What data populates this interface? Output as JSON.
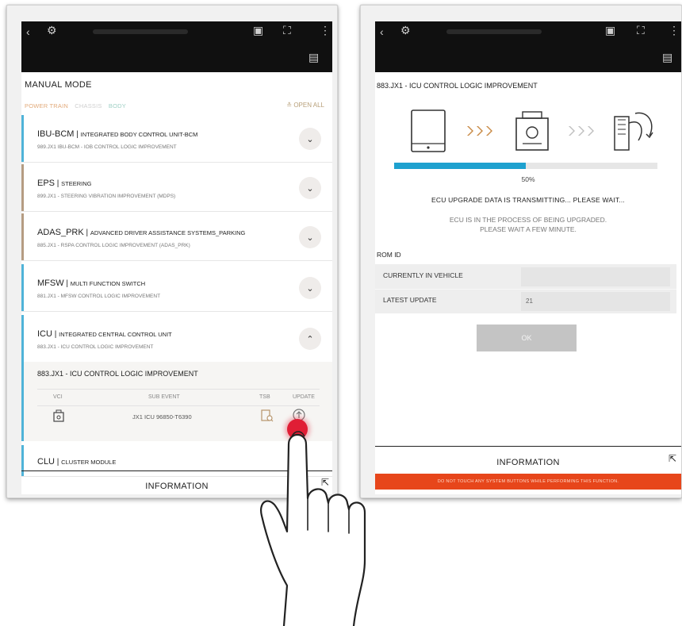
{
  "left_screen": {
    "mode_title": "MANUAL MODE",
    "category_tabs": [
      {
        "label": "POWER TRAIN",
        "color": "#e2aa7a"
      },
      {
        "label": "CHASSIS",
        "color": "#cfcfcf"
      },
      {
        "label": "BODY",
        "color": "#9fd0c5"
      }
    ],
    "open_all": "OPEN ALL",
    "systems": [
      {
        "code": "IBU-BCM",
        "full": "INTEGRATED BODY CONTROL UNIT-BCM",
        "sub": "989.JX1 IBU-BCM - IOB CONTROL LOGIC IMPROVEMENT",
        "accent": "#4fb3d8",
        "expanded": false
      },
      {
        "code": "EPS",
        "full": "STEERING",
        "sub": "899.JX1 - STEERING VIBRATION IMPROVEMENT (MDPS)",
        "accent": "#b59c82",
        "expanded": false
      },
      {
        "code": "ADAS_PRK",
        "full": "ADVANCED DRIVER ASSISTANCE SYSTEMS_PARKING",
        "sub": "885.JX1 - RSPA CONTROL LOGIC IMPROVEMENT (ADAS_PRK)",
        "accent": "#b59c82",
        "expanded": false
      },
      {
        "code": "MFSW",
        "full": "MULTI FUNCTION SWITCH",
        "sub": "881.JX1 - MFSW CONTROL LOGIC IMPROVEMENT",
        "accent": "#4fb3d8",
        "expanded": false
      },
      {
        "code": "ICU",
        "full": "INTEGRATED CENTRAL CONTROL UNIT",
        "sub": "883.JX1 - ICU CONTROL LOGIC IMPROVEMENT",
        "accent": "#4fb3d8",
        "expanded": true
      }
    ],
    "expanded_event": {
      "title": "883.JX1 - ICU CONTROL LOGIC IMPROVEMENT",
      "columns": [
        "VCI",
        "SUB EVENT",
        "TSB",
        "UPDATE"
      ],
      "row": {
        "sub_event": "JX1 ICU 96850-T6390"
      }
    },
    "last_system": {
      "code": "CLU",
      "full": "CLUSTER MODULE"
    },
    "bottom_label": "INFORMATION"
  },
  "right_screen": {
    "title": "883.JX1 - ICU CONTROL LOGIC IMPROVEMENT",
    "progress": 0.5,
    "progress_label": "50%",
    "status_main": "ECU UPGRADE DATA IS TRANSMITTING... PLEASE WAIT...",
    "status_line1": "ECU IS IN THE PROCESS OF BEING UPGRADED.",
    "status_line2": "PLEASE WAIT A FEW MINUTE.",
    "rom_id_label": "ROM ID",
    "rom_rows": [
      {
        "label": "CURRENTLY IN VEHICLE",
        "value": ""
      },
      {
        "label": "LATEST UPDATE",
        "value": "21"
      }
    ],
    "ok_label": "OK",
    "bottom_label": "INFORMATION",
    "warning": "DO NOT TOUCH ANY SYSTEM BUTTONS WHILE PERFORMING THIS FUNCTION."
  },
  "colors": {
    "accent_blue": "#4fb3d8",
    "accent_tan": "#b59c82",
    "progress": "#1ea1cf",
    "warning": "#e7461b",
    "tap_marker": "#e01e35"
  }
}
